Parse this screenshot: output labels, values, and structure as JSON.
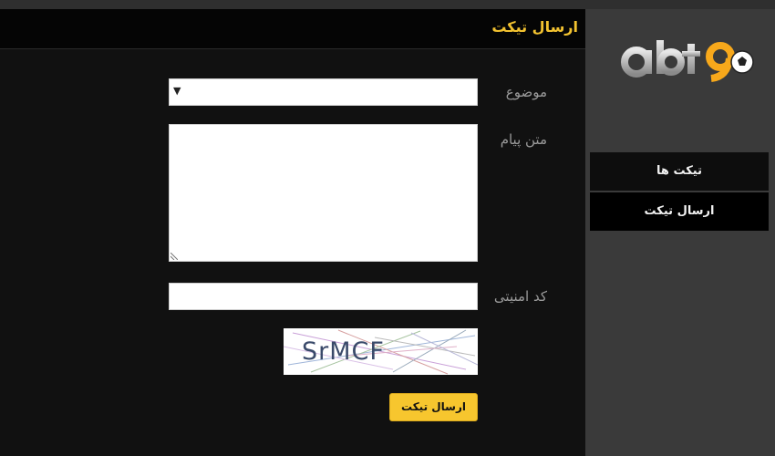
{
  "panel": {
    "title": "ارسال تیکت"
  },
  "form": {
    "subject_label": "موضوع",
    "subject_value": "",
    "message_label": "متن پیام",
    "message_value": "",
    "security_label": "کد امنیتی",
    "security_value": "",
    "captcha_text": "SrMCF",
    "submit_label": "ارسال تیکت"
  },
  "sidebar": {
    "logo": "bt90-logo",
    "items": [
      {
        "label": "تیکت ها",
        "active": false
      },
      {
        "label": "ارسال تیکت",
        "active": true
      }
    ]
  },
  "colors": {
    "accent": "#f7c62e",
    "panel_bg": "#111111",
    "page_bg": "#3a3a3a"
  }
}
